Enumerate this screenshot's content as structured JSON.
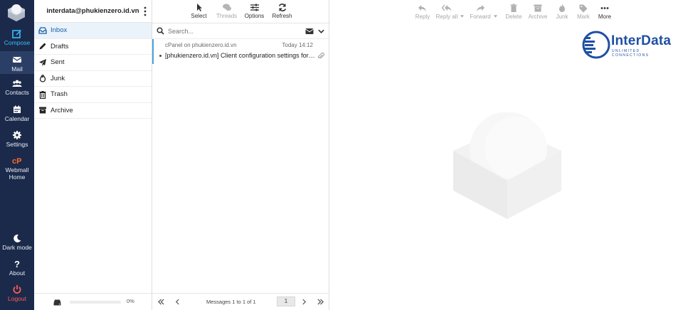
{
  "rail": {
    "compose": "Compose",
    "mail": "Mail",
    "contacts": "Contacts",
    "calendar": "Calendar",
    "settings": "Settings",
    "webmall_line1": "Webmall",
    "webmall_line2": "Home",
    "dark_mode": "Dark mode",
    "about": "About",
    "logout": "Logout"
  },
  "account": {
    "email": "interdata@phukienzero.id.vn"
  },
  "folders": [
    {
      "label": "Inbox",
      "icon": "inbox-icon"
    },
    {
      "label": "Drafts",
      "icon": "pencil-icon"
    },
    {
      "label": "Sent",
      "icon": "paper-plane-icon"
    },
    {
      "label": "Junk",
      "icon": "fire-icon"
    },
    {
      "label": "Trash",
      "icon": "trash-icon"
    },
    {
      "label": "Archive",
      "icon": "archive-icon"
    }
  ],
  "quota": {
    "percent": "0%",
    "fraction": 0
  },
  "list_toolbar": {
    "select": "Select",
    "threads": "Threads",
    "options": "Options",
    "refresh": "Refresh"
  },
  "search": {
    "placeholder": "Search..."
  },
  "messages": [
    {
      "from": "cPanel on phukienzero.id.vn",
      "date": "Today 14:12",
      "subject": "[phukienzero.id.vn] Client configuration settings for “interdata@phukienzero.id.vn”."
    }
  ],
  "pager": {
    "info": "Messages 1 to 1 of 1",
    "page": "1"
  },
  "preview_toolbar": {
    "reply": "Reply",
    "reply_all": "Reply all",
    "forward": "Forward",
    "delete": "Delete",
    "archive": "Archive",
    "junk": "Junk",
    "mark": "Mark",
    "more": "More"
  },
  "logo": {
    "name": "InterData",
    "tagline": "UNLIMITED CONNECTIONS"
  },
  "colors": {
    "rail_bg": "#1b2a4a",
    "accent": "#37beff",
    "logout": "#ff5a5a",
    "brand": "#1f4fa3"
  }
}
